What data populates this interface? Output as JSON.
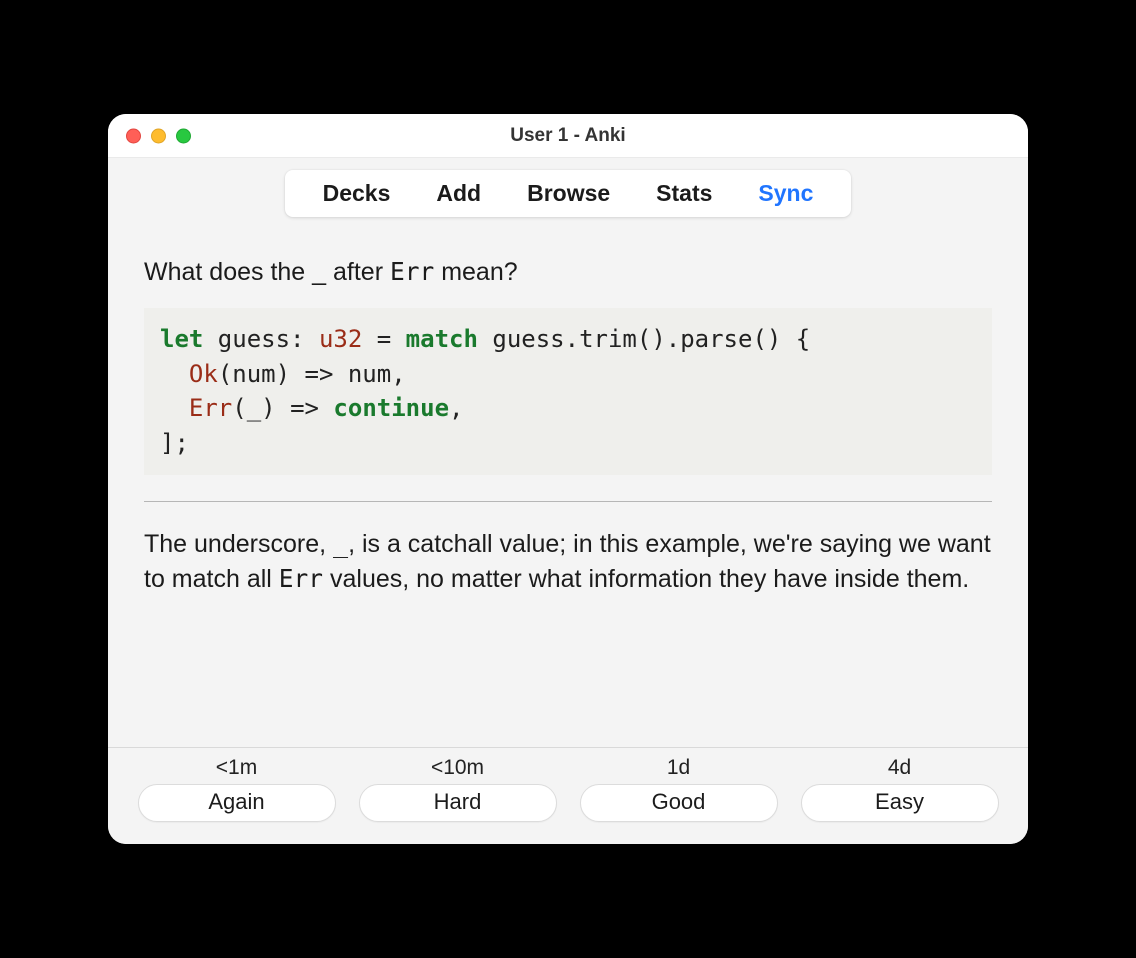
{
  "window": {
    "title": "User 1 - Anki"
  },
  "toolbar": {
    "items": [
      {
        "label": "Decks",
        "active": false
      },
      {
        "label": "Add",
        "active": false
      },
      {
        "label": "Browse",
        "active": false
      },
      {
        "label": "Stats",
        "active": false
      },
      {
        "label": "Sync",
        "active": true
      }
    ]
  },
  "card": {
    "question_prefix": "What does the ",
    "question_underscore": "_",
    "question_mid": " after ",
    "question_code": "Err",
    "question_suffix": " mean?",
    "code": {
      "t_let": "let",
      "t_sp1": " guess: ",
      "t_ty": "u32",
      "t_eq": " = ",
      "t_match": "match",
      "t_l1rest": " guess.trim().parse() {",
      "t_l2pad": "  ",
      "t_ok": "Ok",
      "t_l2rest": "(num) => num,",
      "t_l3pad": "  ",
      "t_err": "Err",
      "t_l3a": "(_) => ",
      "t_continue": "continue",
      "t_l3b": ",",
      "t_l4": "];"
    },
    "answer_p1": "The underscore, ",
    "answer_us": "_",
    "answer_p2": ", is a catchall value; in this example, we're saying we want to match all ",
    "answer_code": "Err",
    "answer_p3": " values, no matter what information they have inside them."
  },
  "answers": [
    {
      "time": "<1m",
      "label": "Again"
    },
    {
      "time": "<10m",
      "label": "Hard"
    },
    {
      "time": "1d",
      "label": "Good"
    },
    {
      "time": "4d",
      "label": "Easy"
    }
  ]
}
